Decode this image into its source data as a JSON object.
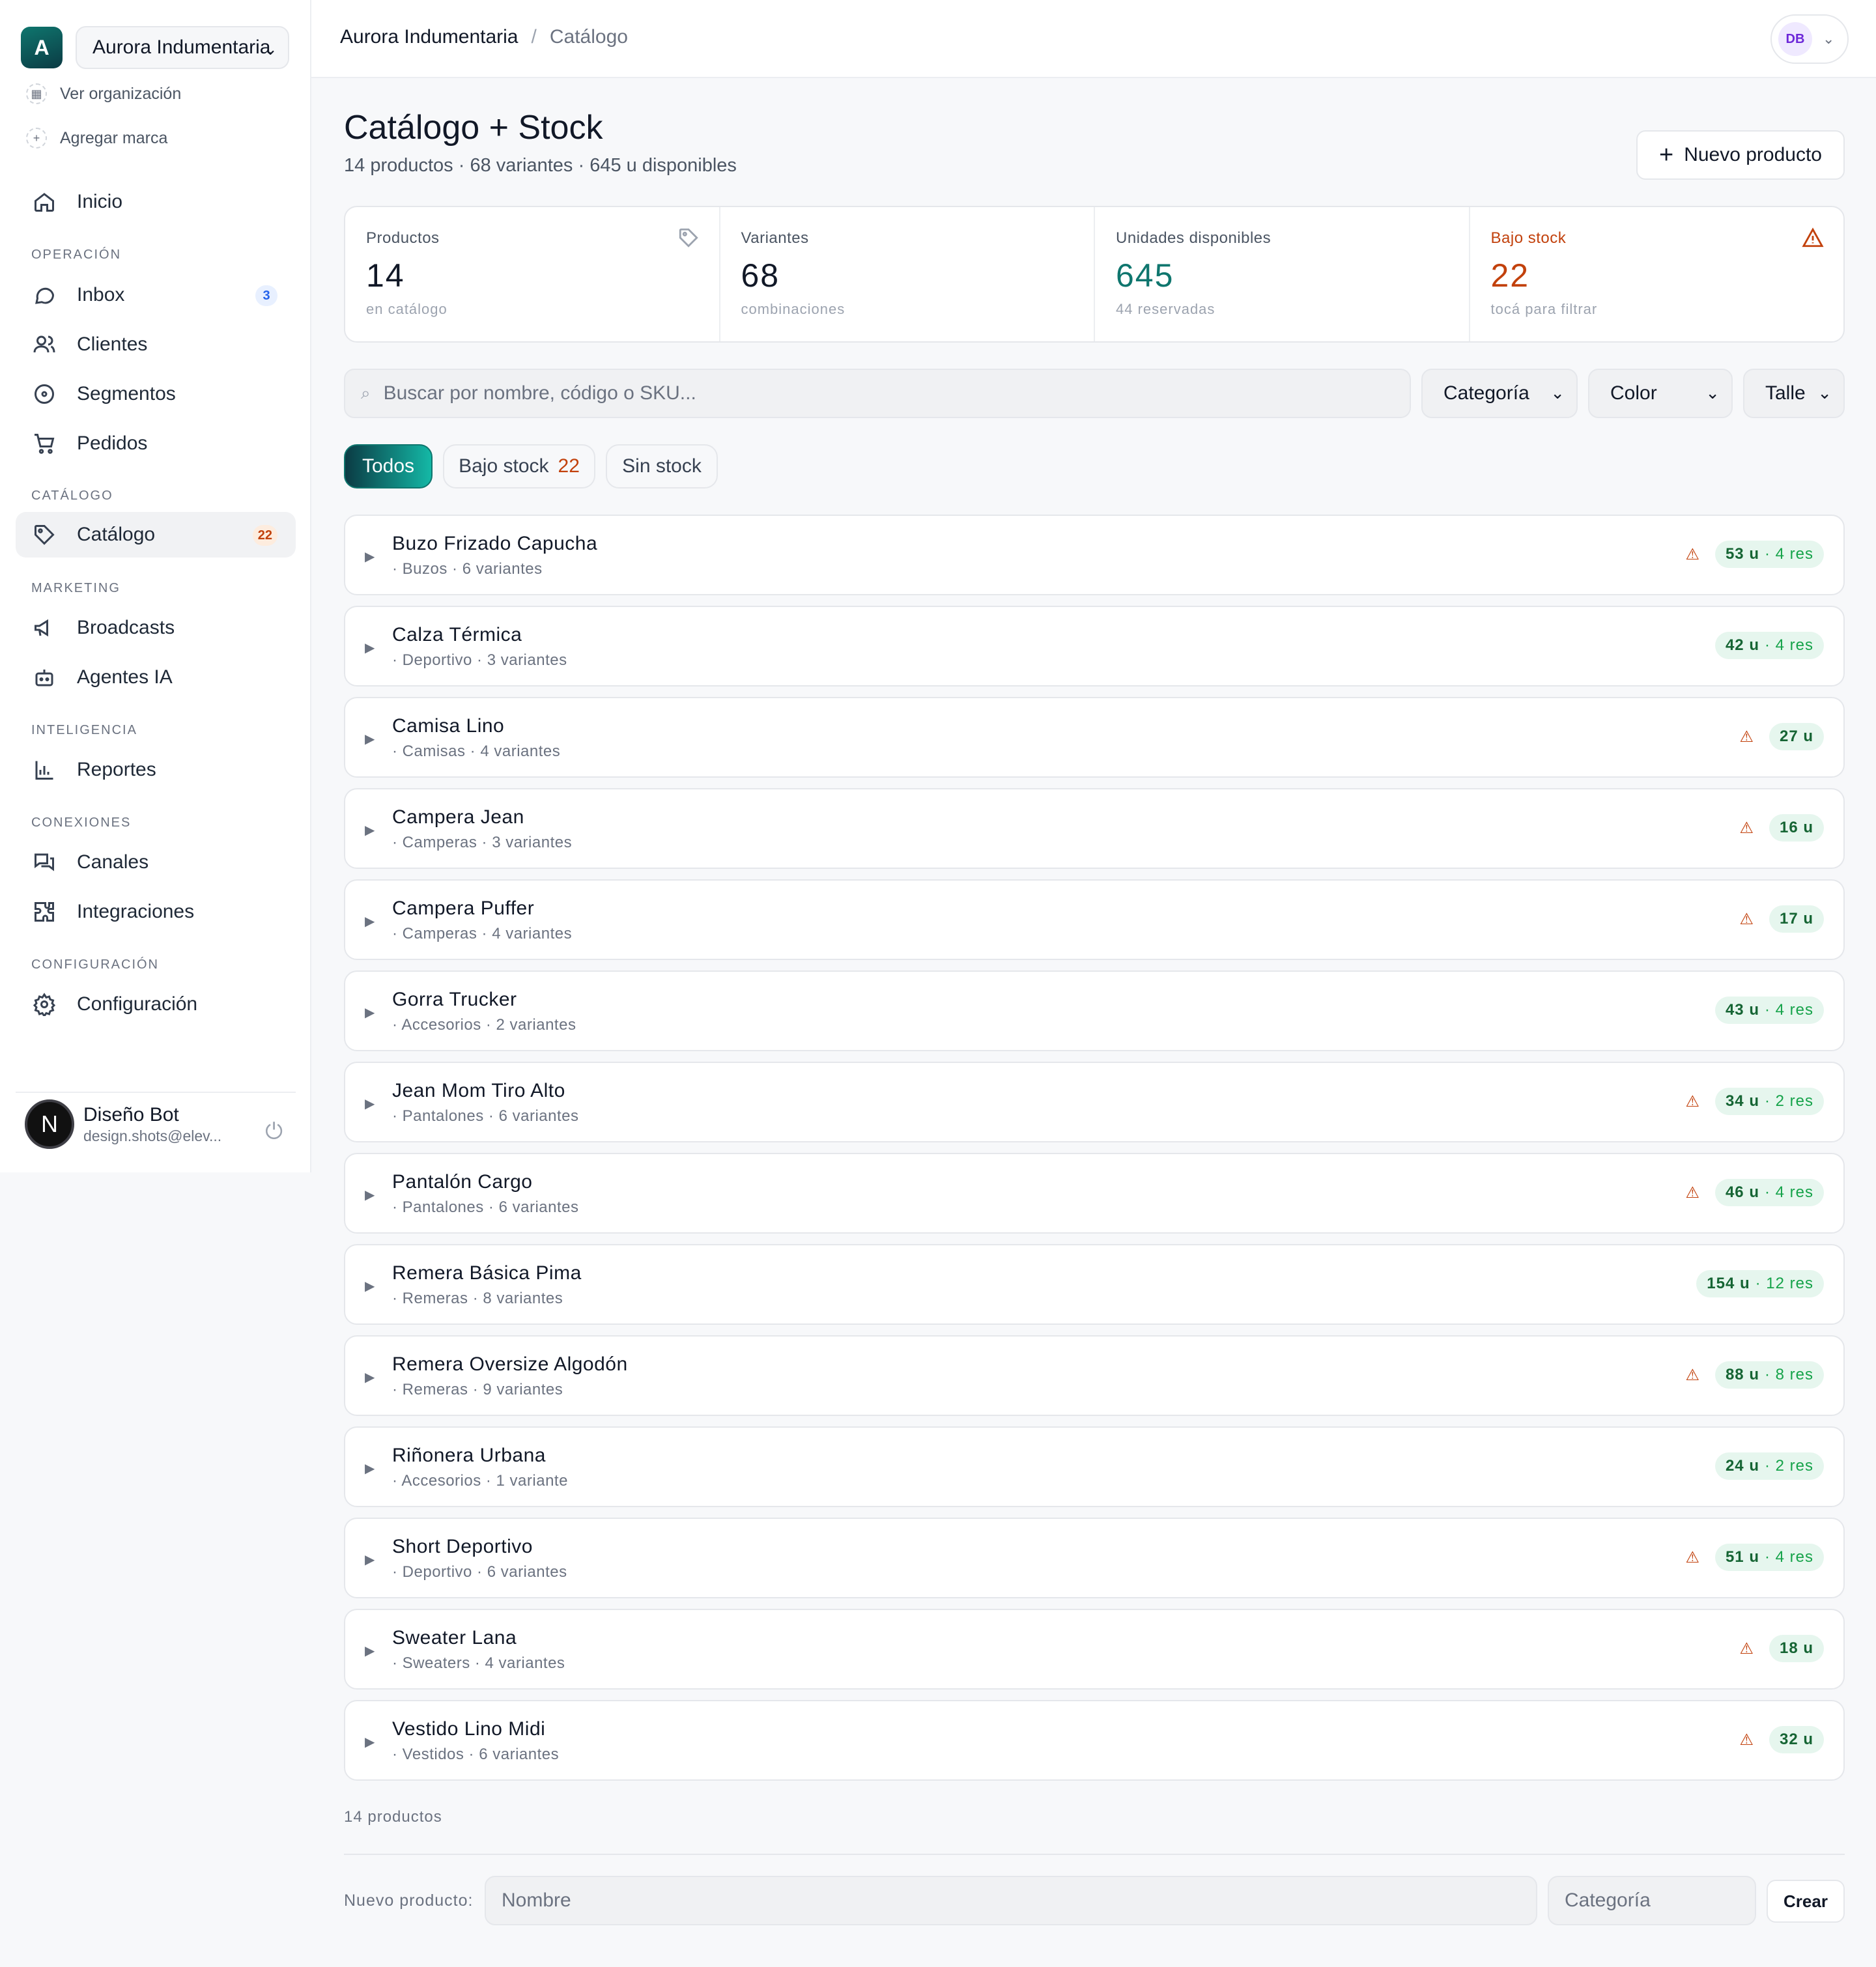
{
  "org": {
    "initial": "A",
    "name": "Aurora Indumentaria",
    "view_org": "Ver organización",
    "add_brand": "Agregar marca"
  },
  "sidebar": {
    "home": "Inicio",
    "sections": {
      "operacion": "OPERACIÓN",
      "catalogo": "CATÁLOGO",
      "marketing": "MARKETING",
      "inteligencia": "INTELIGENCIA",
      "conexiones": "CONEXIONES",
      "configuracion": "CONFIGURACIÓN"
    },
    "items": {
      "inbox": "Inbox",
      "inbox_badge": "3",
      "clientes": "Clientes",
      "segmentos": "Segmentos",
      "pedidos": "Pedidos",
      "catalogo": "Catálogo",
      "catalogo_badge": "22",
      "broadcasts": "Broadcasts",
      "agentes": "Agentes IA",
      "reportes": "Reportes",
      "canales": "Canales",
      "integraciones": "Integraciones",
      "configuracion": "Configuración"
    },
    "user": {
      "initial": "N",
      "name": "Diseño Bot",
      "email": "design.shots@elev..."
    }
  },
  "topbar": {
    "crumb_org": "Aurora Indumentaria",
    "crumb_sep": "/",
    "crumb_page": "Catálogo",
    "user_initials": "DB"
  },
  "header": {
    "title": "Catálogo + Stock",
    "subtitle": "14 productos · 68 variantes · 645 u disponibles",
    "new_product": "Nuevo producto"
  },
  "stats": {
    "productos": {
      "label": "Productos",
      "value": "14",
      "hint": "en catálogo"
    },
    "variantes": {
      "label": "Variantes",
      "value": "68",
      "hint": "combinaciones"
    },
    "unidades": {
      "label": "Unidades disponibles",
      "value": "645",
      "hint": "44 reservadas"
    },
    "bajo": {
      "label": "Bajo stock",
      "value": "22",
      "hint": "tocá para filtrar"
    }
  },
  "filters": {
    "search_placeholder": "Buscar por nombre, código o SKU...",
    "categoria": "Categoría",
    "color": "Color",
    "talle": "Talle"
  },
  "chips": {
    "todos": "Todos",
    "bajo": "Bajo stock",
    "bajo_count": "22",
    "sin": "Sin stock"
  },
  "products": [
    {
      "name": "Buzo Frizado Capucha",
      "meta": "· Buzos · 6 variantes",
      "low": true,
      "units": "53 u",
      "res": "· 4 res"
    },
    {
      "name": "Calza Térmica",
      "meta": "· Deportivo · 3 variantes",
      "low": false,
      "units": "42 u",
      "res": "· 4 res"
    },
    {
      "name": "Camisa Lino",
      "meta": "· Camisas · 4 variantes",
      "low": true,
      "units": "27 u",
      "res": ""
    },
    {
      "name": "Campera Jean",
      "meta": "· Camperas · 3 variantes",
      "low": true,
      "units": "16 u",
      "res": ""
    },
    {
      "name": "Campera Puffer",
      "meta": "· Camperas · 4 variantes",
      "low": true,
      "units": "17 u",
      "res": ""
    },
    {
      "name": "Gorra Trucker",
      "meta": "· Accesorios · 2 variantes",
      "low": false,
      "units": "43 u",
      "res": "· 4 res"
    },
    {
      "name": "Jean Mom Tiro Alto",
      "meta": "· Pantalones · 6 variantes",
      "low": true,
      "units": "34 u",
      "res": "· 2 res"
    },
    {
      "name": "Pantalón Cargo",
      "meta": "· Pantalones · 6 variantes",
      "low": true,
      "units": "46 u",
      "res": "· 4 res"
    },
    {
      "name": "Remera Básica Pima",
      "meta": "· Remeras · 8 variantes",
      "low": false,
      "units": "154 u",
      "res": "· 12 res"
    },
    {
      "name": "Remera Oversize Algodón",
      "meta": "· Remeras · 9 variantes",
      "low": true,
      "units": "88 u",
      "res": "· 8 res"
    },
    {
      "name": "Riñonera Urbana",
      "meta": "· Accesorios · 1 variante",
      "low": false,
      "units": "24 u",
      "res": "· 2 res"
    },
    {
      "name": "Short Deportivo",
      "meta": "· Deportivo · 6 variantes",
      "low": true,
      "units": "51 u",
      "res": "· 4 res"
    },
    {
      "name": "Sweater Lana",
      "meta": "· Sweaters · 4 variantes",
      "low": true,
      "units": "18 u",
      "res": ""
    },
    {
      "name": "Vestido Lino Midi",
      "meta": "· Vestidos · 6 variantes",
      "low": true,
      "units": "32 u",
      "res": ""
    }
  ],
  "footer": {
    "count": "14 productos",
    "new_label": "Nuevo producto:",
    "name_placeholder": "Nombre",
    "category_placeholder": "Categoría",
    "create": "Crear"
  },
  "icons": {
    "warn": "⚠",
    "expand": "▶",
    "power": "⏻",
    "search": "⌕"
  },
  "colors": {
    "accent": "#0f766e",
    "warning": "#c2410c",
    "stock_bg": "#e6f6ee"
  }
}
